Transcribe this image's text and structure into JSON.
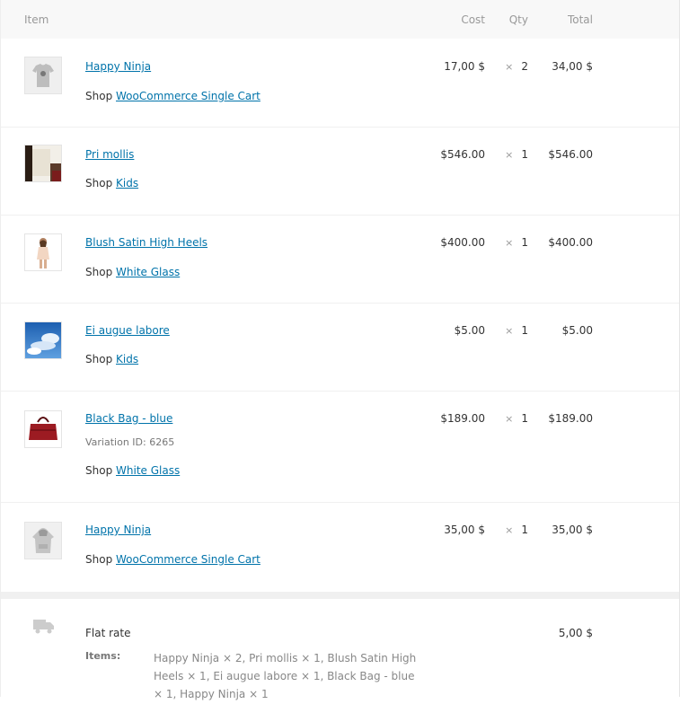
{
  "header": {
    "item": "Item",
    "cost": "Cost",
    "qty": "Qty",
    "total": "Total"
  },
  "items": [
    {
      "name": "Happy Ninja",
      "shop_label": "Shop",
      "shop": "WooCommerce Single Cart",
      "cost": "17,00 $",
      "qty_symbol": "×",
      "qty": "2",
      "total": "34,00 $",
      "thumb": "tshirt-grey"
    },
    {
      "name": "Pri mollis",
      "shop_label": "Shop",
      "shop": "Kids",
      "cost": "$546.00",
      "qty_symbol": "×",
      "qty": "1",
      "total": "$546.00",
      "thumb": "photo-bag"
    },
    {
      "name": "Blush Satin High Heels",
      "shop_label": "Shop",
      "shop": "White Glass",
      "cost": "$400.00",
      "qty_symbol": "×",
      "qty": "1",
      "total": "$400.00",
      "thumb": "woman-dress"
    },
    {
      "name": "Ei augue labore",
      "shop_label": "Shop",
      "shop": "Kids",
      "cost": "$5.00",
      "qty_symbol": "×",
      "qty": "1",
      "total": "$5.00",
      "thumb": "sky-clouds"
    },
    {
      "name": "Black Bag - blue",
      "variation_label": "Variation ID:",
      "variation_id": "6265",
      "shop_label": "Shop",
      "shop": "White Glass",
      "cost": "$189.00",
      "qty_symbol": "×",
      "qty": "1",
      "total": "$189.00",
      "thumb": "red-bag"
    },
    {
      "name": "Happy Ninja",
      "shop_label": "Shop",
      "shop": "WooCommerce Single Cart",
      "cost": "35,00 $",
      "qty_symbol": "×",
      "qty": "1",
      "total": "35,00 $",
      "thumb": "hoodie-grey"
    }
  ],
  "shipping": {
    "icon": "truck-icon",
    "title": "Flat rate",
    "items_label": "Items:",
    "items_value": "Happy Ninja × 2, Pri mollis × 1, Blush Satin High Heels × 1, Ei augue labore × 1, Black Bag - blue × 1, Happy Ninja × 1",
    "total": "5,00 $"
  },
  "colors": {
    "link": "#0073aa",
    "header_bg": "#f8f8f8",
    "muted": "#999999"
  }
}
